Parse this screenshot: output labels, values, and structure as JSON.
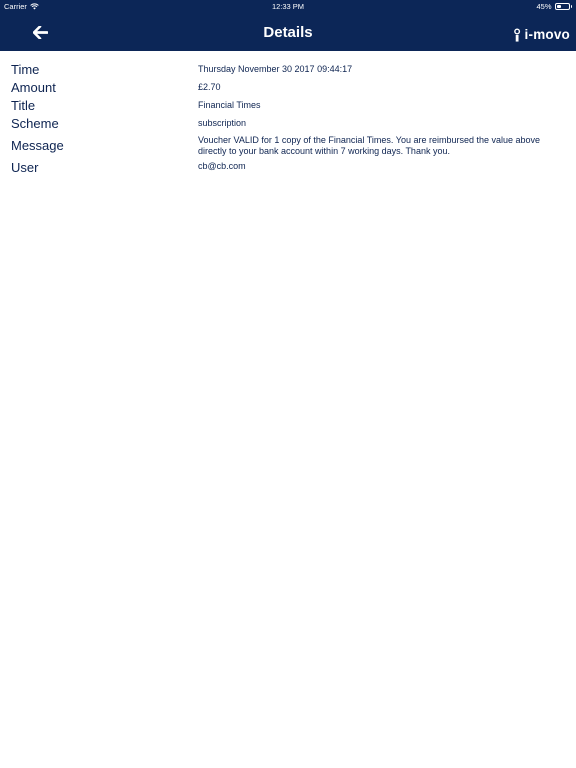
{
  "status_bar": {
    "carrier": "Carrier",
    "time": "12:33 PM",
    "battery": "45%",
    "battery_level": 0.45
  },
  "nav": {
    "back_icon": "arrow-left-icon",
    "title": "Details",
    "brand": "i-movo"
  },
  "details": [
    {
      "label": "Time",
      "value": "Thursday November 30 2017 09:44:17"
    },
    {
      "label": "Amount",
      "value": "£2.70"
    },
    {
      "label": "Title",
      "value": "Financial Times"
    },
    {
      "label": "Scheme",
      "value": "subscription"
    },
    {
      "label": "Message",
      "value": "Voucher VALID for 1 copy of the Financial Times. You are reimbursed the value above directly to your bank account within 7 working days. Thank you."
    },
    {
      "label": "User",
      "value": "cb@cb.com"
    }
  ],
  "colors": {
    "header_bg": "#0c2657",
    "text": "#0e2451",
    "background": "#ffffff"
  }
}
